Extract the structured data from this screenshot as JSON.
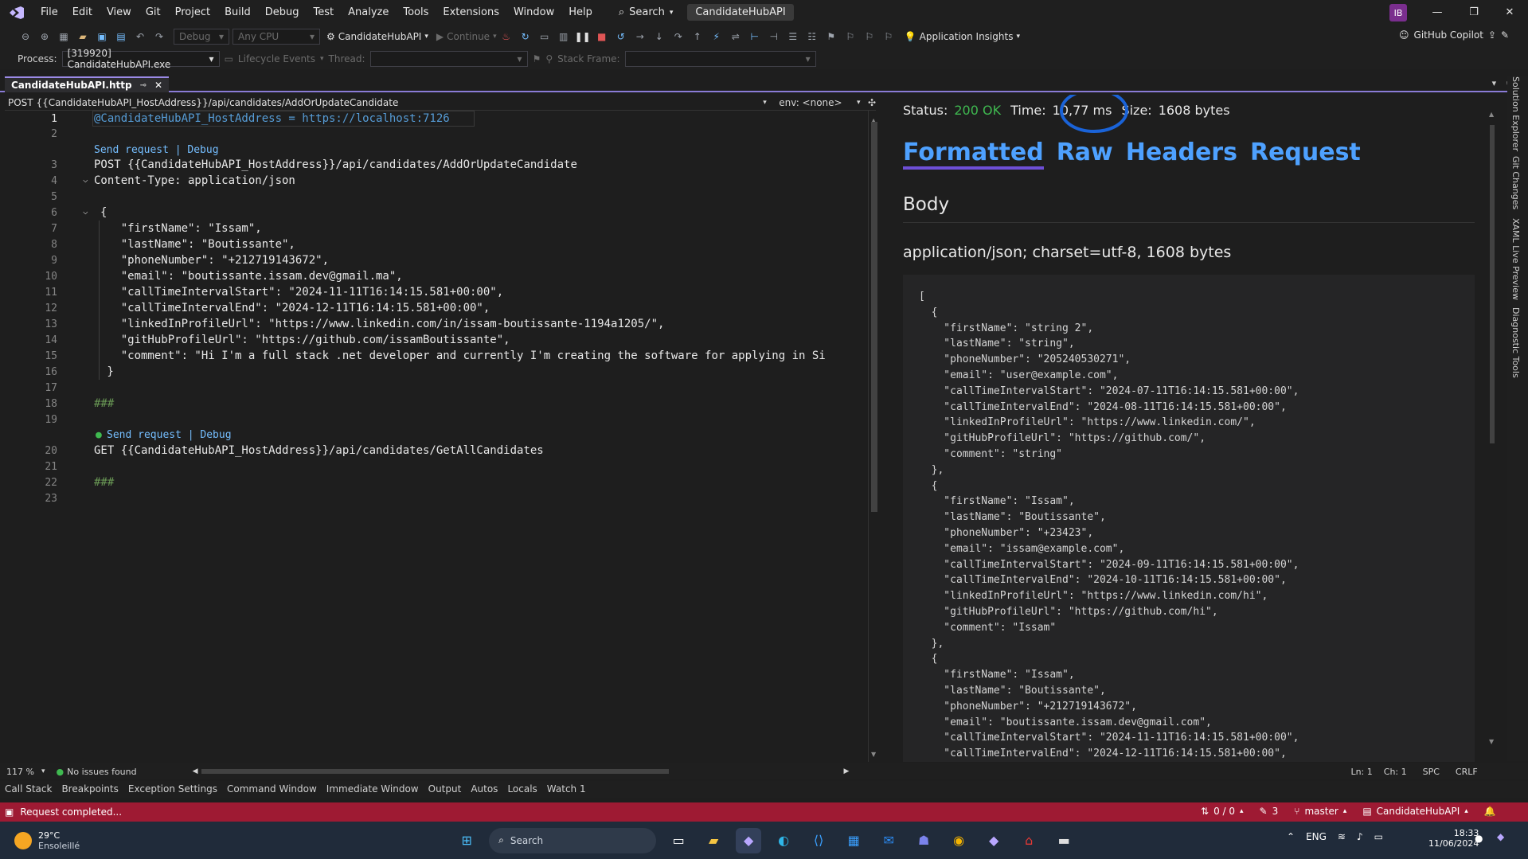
{
  "menubar": {
    "items": [
      "File",
      "Edit",
      "View",
      "Git",
      "Project",
      "Build",
      "Debug",
      "Test",
      "Analyze",
      "Tools",
      "Extensions",
      "Window",
      "Help"
    ],
    "search_label": "Search",
    "solution_name": "CandidateHubAPI",
    "avatar_initials": "IB"
  },
  "toolbar1": {
    "config": "Debug",
    "platform": "Any CPU",
    "startup_project": "CandidateHubAPI",
    "continue_label": "Continue",
    "app_insights": "Application Insights",
    "copilot": "GitHub Copilot"
  },
  "toolbar2": {
    "process_label": "Process:",
    "process_value": "[319920] CandidateHubAPI.exe",
    "lifecycle_label": "Lifecycle Events",
    "thread_label": "Thread:",
    "stackframe_label": "Stack Frame:"
  },
  "tab": {
    "title": "CandidateHubAPI.http"
  },
  "navbar": {
    "request": "POST {{CandidateHubAPI_HostAddress}}/api/candidates/AddOrUpdateCandidate",
    "env": "env: <none>"
  },
  "editor": {
    "lines": [
      {
        "n": "1",
        "text": "@CandidateHubAPI_HostAddress = https://localhost:7126"
      },
      {
        "n": "2",
        "text": ""
      },
      {
        "n": "",
        "text": "Send request | Debug"
      },
      {
        "n": "3",
        "text": "POST {{CandidateHubAPI_HostAddress}}/api/candidates/AddOrUpdateCandidate"
      },
      {
        "n": "4",
        "text": "Content-Type: application/json"
      },
      {
        "n": "5",
        "text": ""
      },
      {
        "n": "6",
        "text": "{"
      },
      {
        "n": "7",
        "text": "    \"firstName\": \"Issam\","
      },
      {
        "n": "8",
        "text": "    \"lastName\": \"Boutissante\","
      },
      {
        "n": "9",
        "text": "    \"phoneNumber\": \"+212719143672\","
      },
      {
        "n": "10",
        "text": "    \"email\": \"boutissante.issam.dev@gmail.ma\","
      },
      {
        "n": "11",
        "text": "    \"callTimeIntervalStart\": \"2024-11-11T16:14:15.581+00:00\","
      },
      {
        "n": "12",
        "text": "    \"callTimeIntervalEnd\": \"2024-12-11T16:14:15.581+00:00\","
      },
      {
        "n": "13",
        "text": "    \"linkedInProfileUrl\": \"https://www.linkedin.com/in/issam-boutissante-1194a1205/\","
      },
      {
        "n": "14",
        "text": "    \"gitHubProfileUrl\": \"https://github.com/issamBoutissante\","
      },
      {
        "n": "15",
        "text": "    \"comment\": \"Hi I'm a full stack .net developer and currently I'm creating the software for applying in Si"
      },
      {
        "n": "16",
        "text": " }"
      },
      {
        "n": "17",
        "text": ""
      },
      {
        "n": "18",
        "text": "###"
      },
      {
        "n": "19",
        "text": ""
      },
      {
        "n": "",
        "text": "Send request | Debug"
      },
      {
        "n": "20",
        "text": "GET {{CandidateHubAPI_HostAddress}}/api/candidates/GetAllCandidates"
      },
      {
        "n": "21",
        "text": ""
      },
      {
        "n": "22",
        "text": "###"
      },
      {
        "n": "23",
        "text": ""
      }
    ]
  },
  "response": {
    "status_label": "Status:",
    "status_value": "200 OK",
    "time_label": "Time:",
    "time_value": "10,77 ms",
    "size_label": "Size:",
    "size_value": "1608 bytes",
    "tabs": [
      "Formatted",
      "Raw",
      "Headers",
      "Request"
    ],
    "body_heading": "Body",
    "content_type": "application/json; charset=utf-8, 1608 bytes",
    "json_lines": [
      "[",
      "  {",
      "    \"firstName\": \"string 2\",",
      "    \"lastName\": \"string\",",
      "    \"phoneNumber\": \"205240530271\",",
      "    \"email\": \"user@example.com\",",
      "    \"callTimeIntervalStart\": \"2024-07-11T16:14:15.581+00:00\",",
      "    \"callTimeIntervalEnd\": \"2024-08-11T16:14:15.581+00:00\",",
      "    \"linkedInProfileUrl\": \"https://www.linkedin.com/\",",
      "    \"gitHubProfileUrl\": \"https://github.com/\",",
      "    \"comment\": \"string\"",
      "  },",
      "  {",
      "    \"firstName\": \"Issam\",",
      "    \"lastName\": \"Boutissante\",",
      "    \"phoneNumber\": \"+23423\",",
      "    \"email\": \"issam@example.com\",",
      "    \"callTimeIntervalStart\": \"2024-09-11T16:14:15.581+00:00\",",
      "    \"callTimeIntervalEnd\": \"2024-10-11T16:14:15.581+00:00\",",
      "    \"linkedInProfileUrl\": \"https://www.linkedin.com/hi\",",
      "    \"gitHubProfileUrl\": \"https://github.com/hi\",",
      "    \"comment\": \"Issam\"",
      "  },",
      "  {",
      "    \"firstName\": \"Issam\",",
      "    \"lastName\": \"Boutissante\",",
      "    \"phoneNumber\": \"+212719143672\",",
      "    \"email\": \"boutissante.issam.dev@gmail.com\",",
      "    \"callTimeIntervalStart\": \"2024-11-11T16:14:15.581+00:00\",",
      "    \"callTimeIntervalEnd\": \"2024-12-11T16:14:15.581+00:00\","
    ]
  },
  "right_sidebar": [
    "Solution Explorer",
    "Git Changes",
    "XAML Live Preview",
    "Diagnostic Tools"
  ],
  "editor_status": {
    "zoom": "117 %",
    "issues": "No issues found",
    "ln": "Ln: 1",
    "ch": "Ch: 1",
    "spc": "SPC",
    "eol": "CRLF"
  },
  "tool_windows": [
    "Call Stack",
    "Breakpoints",
    "Exception Settings",
    "Command Window",
    "Immediate Window",
    "Output",
    "Autos",
    "Locals",
    "Watch 1"
  ],
  "statusbar": {
    "message": "Request completed...",
    "arrows": "0 / 0",
    "pencil": "3",
    "branch": "master",
    "repo": "CandidateHubAPI"
  },
  "taskbar": {
    "temp": "29°C",
    "weather": "Ensoleillé",
    "search": "Search",
    "lang": "ENG",
    "time": "18:33",
    "date": "11/06/2024"
  },
  "colors": {
    "accent": "#8a7bd6",
    "status_ok": "#3fb950",
    "statusbar": "#9e1a33",
    "highlight_circle": "#1a63d8"
  }
}
